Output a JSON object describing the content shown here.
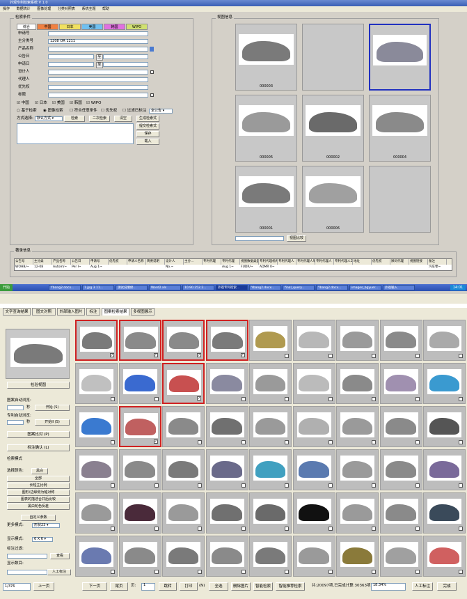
{
  "window": {
    "title": "外观专利检索系统 V 1.0"
  },
  "menu": [
    "操作",
    "数据统计",
    "图像处理",
    "分类对照表",
    "系统主题",
    "帮助"
  ],
  "search_panel": {
    "title": "检索条件",
    "tabs": [
      "综合",
      "中国",
      "日本",
      "美国",
      "韩国",
      "WIPO"
    ],
    "fields": [
      {
        "label": "申请号",
        "value": ""
      },
      {
        "label": "主分类号",
        "value": "1208 OR 1211"
      },
      {
        "label": "产品名称",
        "value": ""
      },
      {
        "label": "公告日",
        "value": ""
      },
      {
        "label": "申请日",
        "value": ""
      },
      {
        "label": "设计人",
        "value": ""
      },
      {
        "label": "代理人",
        "value": ""
      },
      {
        "label": "优先权",
        "value": ""
      },
      {
        "label": "标题",
        "value": ""
      }
    ],
    "date_sep": "至",
    "countries": [
      "中国",
      "日本",
      "美国",
      "韩国",
      "WIPO"
    ],
    "options": [
      "基于检索",
      "图像检索",
      "符合任意条件",
      "优先权",
      "过滤已标注"
    ],
    "options_select": "全公告",
    "method_label": "方式选择:",
    "method_value": "默认方式",
    "buttons": {
      "search": "检索",
      "secondary": "二次检索",
      "clear": "清空",
      "gen": "生成检索式",
      "submit": "提交检索式",
      "save": "保存",
      "load": "载入"
    }
  },
  "view_panel": {
    "title": "视图信息",
    "thumbs": [
      {
        "caption": "000003",
        "car": "#7a7a7a",
        "selected": false
      },
      {
        "caption": "",
        "car": "",
        "selected": false
      },
      {
        "caption": "",
        "car": "#8a8a9a",
        "selected": true
      },
      {
        "caption": "000005",
        "car": "#9a9a9a",
        "selected": false
      },
      {
        "caption": "000002",
        "car": "#6a6a6a",
        "selected": false
      },
      {
        "caption": "000004",
        "car": "#8a8a8a",
        "selected": false
      },
      {
        "caption": "000001",
        "car": "#7a7a7a",
        "selected": false
      },
      {
        "caption": "000006",
        "car": "#a0a0a0",
        "selected": false
      },
      {
        "caption": "",
        "car": "",
        "selected": false
      }
    ],
    "enlarge_button": "视图比较"
  },
  "patent_panel": {
    "title": "著录信息",
    "columns": [
      "公告号",
      "主分类",
      "产品名称",
      "公告日",
      "申请号",
      "优先权",
      "申请人名称",
      "简要说明",
      "设计人",
      "主分...",
      "专利代理",
      "专利代理",
      "视图数据类型",
      "专利代理机构名称",
      "专利代理人",
      "专利代理人单位名称",
      "专利代理人",
      "专利代理人工作单位",
      "地址",
      "优先权",
      "顾问代理",
      "视图链接",
      "备注"
    ],
    "row": [
      "WOHB/~",
      "12-08",
      "Autom/~",
      "Per I~",
      "Aug 1~",
      "",
      "",
      "",
      "No.~",
      "",
      "",
      "Aug 1~",
      "FUDR/~",
      "ADMR 0~",
      "",
      "",
      "",
      "",
      "",
      "",
      "",
      "",
      "汽车零~"
    ]
  },
  "taskbar": {
    "start": "开始",
    "tasks": [
      "Ybang2.docx...",
      "1.jpg 3 11...",
      "测试说明修...",
      "Word2.xls",
      "10.90.252.2...",
      "外观专利检索...",
      "Ybang2.docx...",
      "final_query...",
      "Ybang2.docx...",
      "images_bgyuer...",
      "外观输入"
    ],
    "clock": "14:01"
  },
  "result": {
    "tabs": [
      "文字查询结果",
      "图文对照",
      "外部输入图片",
      "标注",
      "图案检索结果",
      "多视图展示"
    ],
    "active_tab": 4,
    "preview_label": "检验视图",
    "auto_match_label": "图案自动浏览:",
    "auto_unit": "秒",
    "start_btn": "开始  (S)",
    "patent_auto_label": "专利自动浏览:",
    "patent_start_btn": "开始II  (S)",
    "compare_btn": "图案比对  (P)",
    "mark_btn": "标注确认  (L)",
    "mode_label": "检索模式",
    "color_label": "选择颜色:",
    "color_value": "黑白",
    "mode_options": [
      "全部",
      "长短主比例",
      "图形/边缘侧为轴对称",
      "图表的描述合并后比较",
      "黑白轮色反差"
    ],
    "custom_btn": "自定义参数",
    "more_label": "更多模式:",
    "more_value": "形状23",
    "display_label": "显示模式:",
    "display_value": "6 X 6",
    "mark_filter_label": "标注过滤:",
    "view_btn": "查看",
    "display_num_label": "显示数目:",
    "manual_mark_btn": "人工标注",
    "grid": [
      {
        "car": "#7a7a7a",
        "sel": true,
        "chk": true
      },
      {
        "car": "#8a8a8a",
        "sel": true,
        "chk": true
      },
      {
        "car": "#8a8a8a",
        "sel": true,
        "chk": true
      },
      {
        "car": "#7a7a7a",
        "sel": true,
        "chk": true
      },
      {
        "car": "#b09a50",
        "sel": false,
        "chk": false
      },
      {
        "car": "#b8b8b8",
        "sel": false,
        "chk": false
      },
      {
        "car": "#9a9a9a",
        "sel": false,
        "chk": false
      },
      {
        "car": "#8a8a8a",
        "sel": false,
        "chk": false
      },
      {
        "car": "#aaaaaa",
        "sel": false,
        "chk": false
      },
      {
        "car": "#c0c0c0",
        "sel": false,
        "chk": false
      },
      {
        "car": "#3a6ad0",
        "sel": false,
        "chk": false
      },
      {
        "car": "#c85050",
        "sel": true,
        "chk": true
      },
      {
        "car": "#8a8aa0",
        "sel": false,
        "chk": false
      },
      {
        "car": "#9a9a9a",
        "sel": false,
        "chk": false
      },
      {
        "car": "#bbbbbb",
        "sel": false,
        "chk": false
      },
      {
        "car": "#8a8a8a",
        "sel": false,
        "chk": false
      },
      {
        "car": "#a090b0",
        "sel": false,
        "chk": false
      },
      {
        "car": "#3a9ad0",
        "sel": false,
        "chk": false
      },
      {
        "car": "#3a7ad0",
        "sel": false,
        "chk": false
      },
      {
        "car": "#c06060",
        "sel": true,
        "chk": true
      },
      {
        "car": "#8a8a8a",
        "sel": false,
        "chk": false
      },
      {
        "car": "#707070",
        "sel": false,
        "chk": false
      },
      {
        "car": "#9a9a9a",
        "sel": false,
        "chk": false
      },
      {
        "car": "#b0b0b0",
        "sel": false,
        "chk": false
      },
      {
        "car": "#9a9a9a",
        "sel": false,
        "chk": false
      },
      {
        "car": "#8a8a8a",
        "sel": false,
        "chk": false
      },
      {
        "car": "#555555",
        "sel": false,
        "chk": false
      },
      {
        "car": "#8a8090",
        "sel": false,
        "chk": false
      },
      {
        "car": "#8a8a8a",
        "sel": false,
        "chk": false
      },
      {
        "car": "#7a7a7a",
        "sel": false,
        "chk": false
      },
      {
        "car": "#6a6a8a",
        "sel": false,
        "chk": false
      },
      {
        "car": "#40a0c0",
        "sel": false,
        "chk": false
      },
      {
        "car": "#5a7ab0",
        "sel": false,
        "chk": false
      },
      {
        "car": "#9a9a9a",
        "sel": false,
        "chk": false
      },
      {
        "car": "#8a8a8a",
        "sel": false,
        "chk": false
      },
      {
        "car": "#7a6a9a",
        "sel": false,
        "chk": false
      },
      {
        "car": "#9a9a9a",
        "sel": false,
        "chk": false
      },
      {
        "car": "#4a2a3a",
        "sel": false,
        "chk": false
      },
      {
        "car": "#9a9a9a",
        "sel": false,
        "chk": false
      },
      {
        "car": "#707070",
        "sel": false,
        "chk": false
      },
      {
        "car": "#6a6a6a",
        "sel": false,
        "chk": false
      },
      {
        "car": "#111111",
        "sel": false,
        "chk": false
      },
      {
        "car": "#9a9a9a",
        "sel": false,
        "chk": false
      },
      {
        "car": "#8a8a8a",
        "sel": false,
        "chk": false
      },
      {
        "car": "#3a4a5a",
        "sel": false,
        "chk": false
      },
      {
        "car": "#6a7ab0",
        "sel": false,
        "chk": false
      },
      {
        "car": "#8a8a8a",
        "sel": false,
        "chk": false
      },
      {
        "car": "#7a7a7a",
        "sel": false,
        "chk": false
      },
      {
        "car": "#8a8a8a",
        "sel": false,
        "chk": false
      },
      {
        "car": "#7a7a7a",
        "sel": false,
        "chk": false
      },
      {
        "car": "#9a9a9a",
        "sel": false,
        "chk": false
      },
      {
        "car": "#8a7a3a",
        "sel": false,
        "chk": false
      },
      {
        "car": "#a0a0a0",
        "sel": false,
        "chk": false
      },
      {
        "car": "#d06060",
        "sel": false,
        "chk": false
      }
    ]
  },
  "bottom_bar": {
    "page": "1/376",
    "btns": [
      "上一页",
      "下一页",
      "尾页",
      "页:",
      "跳转",
      "打印",
      "全选",
      "删除图片",
      "智能检索",
      "智能推荐检索",
      "人工标注",
      "完成"
    ],
    "page_input": "1",
    "print_hint": "(N)",
    "status": "共:20097项,已完成计算:30363项",
    "progress": "18.34%"
  }
}
